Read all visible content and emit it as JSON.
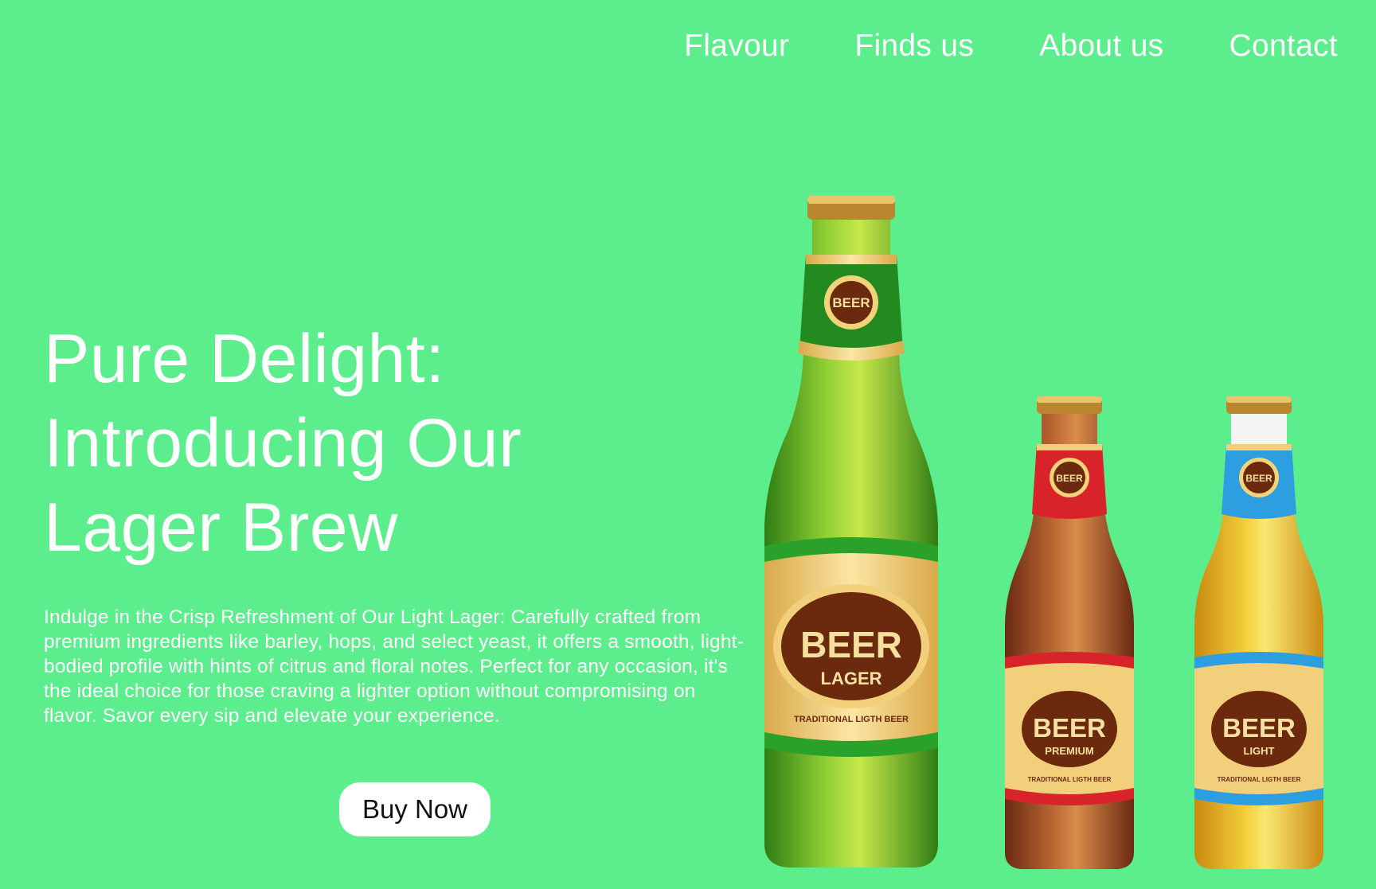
{
  "nav": {
    "items": [
      {
        "label": "Flavour"
      },
      {
        "label": "Finds us"
      },
      {
        "label": "About us"
      },
      {
        "label": "Contact"
      }
    ]
  },
  "hero": {
    "title_lines": [
      "Pure Delight:",
      "Introducing Our",
      "Lager Brew"
    ],
    "description": "Indulge in the Crisp Refreshment of Our Light Lager: Carefully crafted from premium ingredients like barley, hops, and select yeast, it offers a smooth, light-bodied profile with hints of citrus and floral notes. Perfect for any occasion, it's the ideal choice for those craving a lighter option without compromising on flavor. Savor every sip and elevate your experience.",
    "cta_label": "Buy Now"
  },
  "bottles": [
    {
      "brand": "BEER",
      "variant": "LAGER",
      "tagline": "TRADITIONAL LIGTH BEER",
      "colors": {
        "glass": "#3f9a1e",
        "glass_light": "#a8d83a",
        "band": "#2aa12a"
      }
    },
    {
      "brand": "BEER",
      "variant": "PREMIUM",
      "tagline": "TRADITIONAL LIGTH BEER",
      "colors": {
        "glass": "#8a3f1c",
        "glass_light": "#c8743c",
        "band": "#d8232a"
      }
    },
    {
      "brand": "BEER",
      "variant": "LIGHT",
      "tagline": "TRADITIONAL LIGTH BEER",
      "colors": {
        "glass": "#e0a41c",
        "glass_light": "#f6dc4e",
        "band": "#2d9ee0"
      }
    }
  ],
  "colors": {
    "background": "#5ced8d",
    "text": "#ffffff",
    "button_bg": "#ffffff",
    "button_text": "#111111"
  }
}
